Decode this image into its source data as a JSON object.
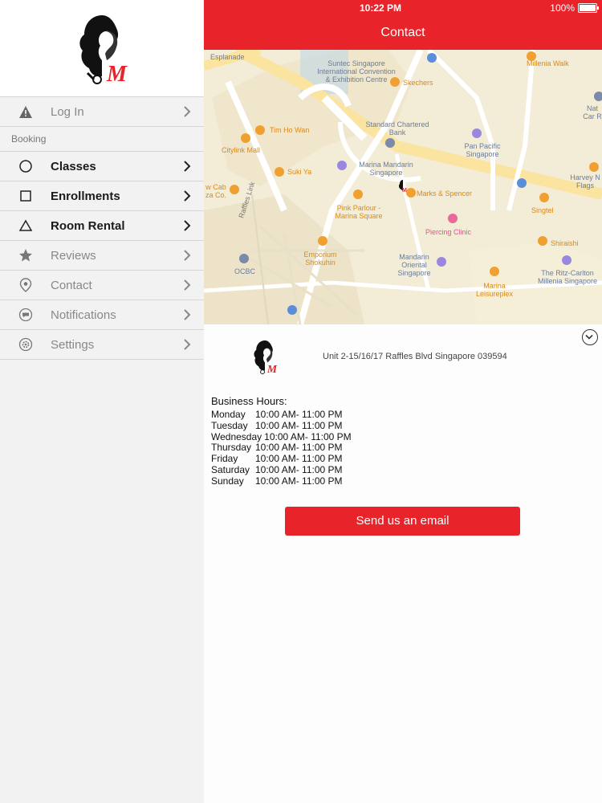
{
  "status_bar": {
    "time": "10:22 PM",
    "battery": "100%"
  },
  "header": {
    "title": "Contact"
  },
  "sidebar": {
    "login_label": "Log In",
    "section_label": "Booking",
    "items": [
      {
        "label": "Classes",
        "icon": "circle-icon"
      },
      {
        "label": "Enrollments",
        "icon": "square-icon"
      },
      {
        "label": "Room Rental",
        "icon": "triangle-icon"
      },
      {
        "label": "Reviews",
        "icon": "star-icon"
      },
      {
        "label": "Contact",
        "icon": "location-pin-icon"
      },
      {
        "label": "Notifications",
        "icon": "chat-bubble-icon"
      },
      {
        "label": "Settings",
        "icon": "gear-icon"
      }
    ]
  },
  "map": {
    "labels": {
      "esplanade": "Esplanade",
      "suntec": "Suntec Singapore International Convention & Exhibition Centre",
      "skechers": "Skechers",
      "millenia_walk": "Millenia Walk",
      "standard_chartered": "Standard Chartered Bank",
      "tim_ho_wan": "Tim Ho Wan",
      "citylink": "Citylink Mall",
      "pan_pacific": "Pan Pacific Singapore",
      "marina_mandarin": "Marina Mandarin Singapore",
      "suki_ya": "Suki Ya",
      "marks_spencer": "Marks & Spencer",
      "raffles_link": "Raffles Link",
      "pink_parlour": "Pink Parlour - Marina Square",
      "singtel": "Singtel",
      "harvey": "Harvey N Flags",
      "nat_car": "Nat Car R",
      "piercing": "Piercing Clinic",
      "shiraishi": "Shiraishi",
      "emporium": "Emporium Shokuhin",
      "mandarin_oriental": "Mandarin Oriental Singapore",
      "ritz": "The Ritz-Carlton Millenia Singapore",
      "ocbc": "OCBC",
      "marina_leisureplex": "Marina Leisureplex",
      "wcab": "w Cab za Co."
    }
  },
  "details": {
    "address": "Unit 2-15/16/17 Raffles Blvd Singapore 039594",
    "hours_title": "Business Hours:",
    "hours": [
      {
        "day": "Monday",
        "time": "10:00 AM- 11:00 PM"
      },
      {
        "day": "Tuesday",
        "time": "10:00 AM- 11:00 PM"
      },
      {
        "day": "Wednesday",
        "time": "10:00 AM- 11:00 PM"
      },
      {
        "day": "Thursday",
        "time": "10:00 AM- 11:00 PM"
      },
      {
        "day": "Friday",
        "time": "10:00 AM- 11:00 PM"
      },
      {
        "day": "Saturday",
        "time": "10:00 AM- 11:00 PM"
      },
      {
        "day": "Sunday",
        "time": "10:00 AM- 11:00 PM"
      }
    ],
    "email_button": "Send us an email"
  },
  "colors": {
    "brand_red": "#e8232a",
    "map_bg": "#f5efd9",
    "road": "#fbe7a6"
  }
}
